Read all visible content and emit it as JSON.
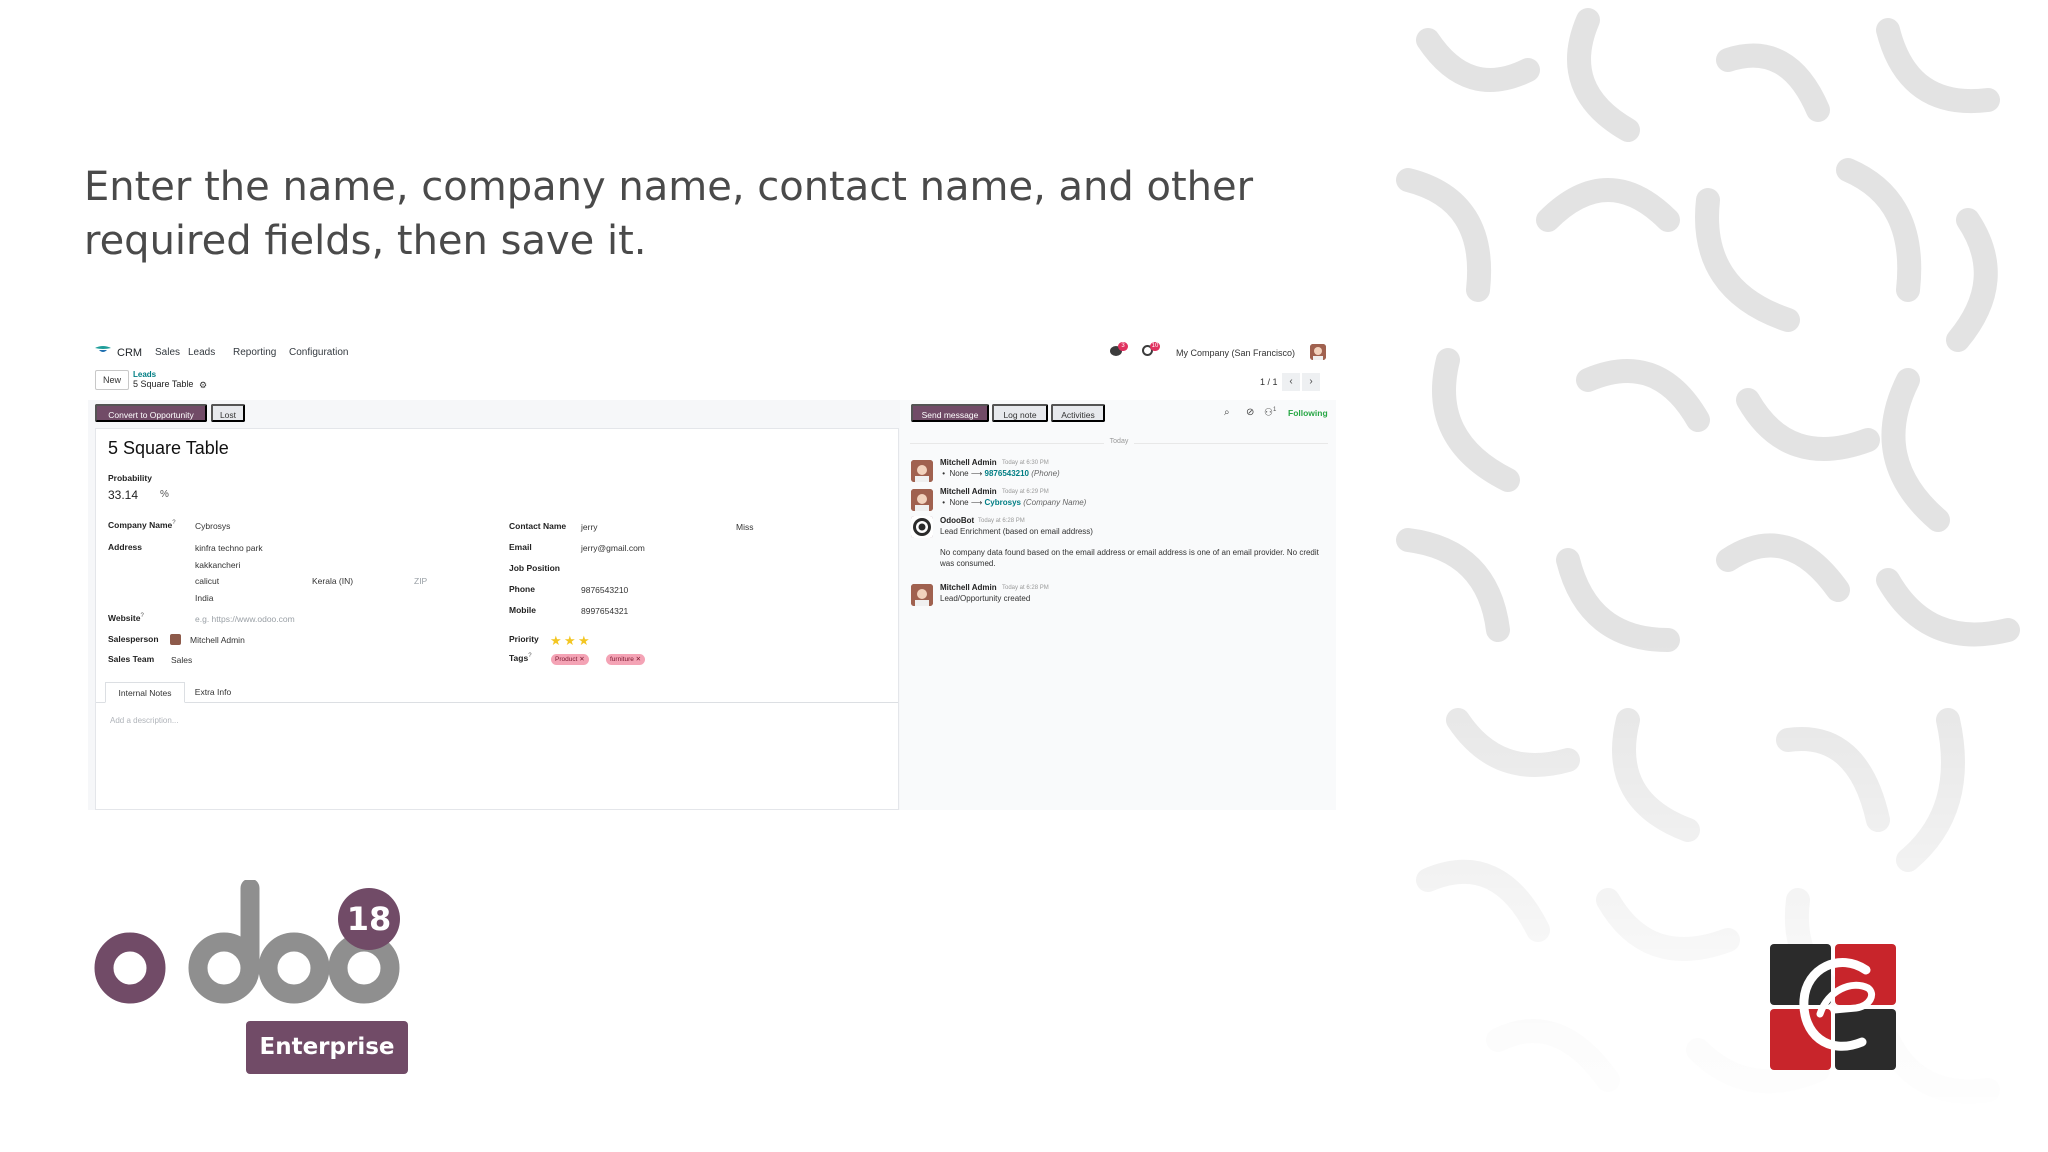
{
  "slide": {
    "instruction": "Enter the name, company name, contact name, and other required fields, then save it.",
    "enterprise_label": "Enterprise",
    "odoo_version": "18",
    "odoo_wordmark": "odoo"
  },
  "navbar": {
    "app_name": "CRM",
    "menu": [
      "Sales",
      "Leads",
      "Reporting",
      "Configuration"
    ],
    "messages_count": "3",
    "activities_count": "10",
    "company": "My Company (San Francisco)"
  },
  "control_panel": {
    "new_label": "New",
    "breadcrumb_parent": "Leads",
    "breadcrumb_current": "5 Square Table",
    "pager": "1 / 1"
  },
  "form": {
    "convert_label": "Convert to Opportunity",
    "lost_label": "Lost",
    "title": "5 Square Table",
    "probability_label": "Probability",
    "probability_value": "33.14",
    "percent_sign": "%",
    "company_name_label": "Company Name",
    "company_name": "Cybrosys",
    "address_label": "Address",
    "street": "kinfra techno park",
    "street2": "kakkancheri",
    "city": "calicut",
    "state": "Kerala (IN)",
    "zip_placeholder": "ZIP",
    "country": "India",
    "website_label": "Website",
    "website_placeholder": "e.g. https://www.odoo.com",
    "salesperson_label": "Salesperson",
    "salesperson": "Mitchell Admin",
    "sales_team_label": "Sales Team",
    "sales_team": "Sales",
    "contact_name_label": "Contact Name",
    "contact_name": "jerry",
    "title_value": "Miss",
    "email_label": "Email",
    "email": "jerry@gmail.com",
    "job_position_label": "Job Position",
    "phone_label": "Phone",
    "phone": "9876543210",
    "mobile_label": "Mobile",
    "mobile": "8997654321",
    "priority_label": "Priority",
    "priority_stars": 3,
    "tags_label": "Tags",
    "tags": [
      "Product",
      "furniture"
    ],
    "tabs": [
      "Internal Notes",
      "Extra Info"
    ],
    "description_placeholder": "Add a description..."
  },
  "chatter": {
    "send_message": "Send message",
    "log_note": "Log note",
    "activities": "Activities",
    "followers_count": "1",
    "following": "Following",
    "today": "Today",
    "messages": [
      {
        "author": "Mitchell Admin",
        "time": "Today at 6:30 PM",
        "old": "None",
        "new": "9876543210",
        "field": "(Phone)"
      },
      {
        "author": "Mitchell Admin",
        "time": "Today at 6:29 PM",
        "old": "None",
        "new": "Cybrosys",
        "field": "(Company Name)"
      },
      {
        "author": "OdooBot",
        "time": "Today at 6:28 PM",
        "text": "Lead Enrichment (based on email address)",
        "text2": "No company data found based on the email address or email address is one of an email provider. No credit was consumed."
      },
      {
        "author": "Mitchell Admin",
        "time": "Today at 6:28 PM",
        "text": "Lead/Opportunity created"
      }
    ]
  },
  "colors": {
    "odoo_purple": "#714b67",
    "teal": "#017e84",
    "following_green": "#28a745",
    "tag_pink": "#f4a3b5",
    "star_yellow": "#f3c622"
  }
}
